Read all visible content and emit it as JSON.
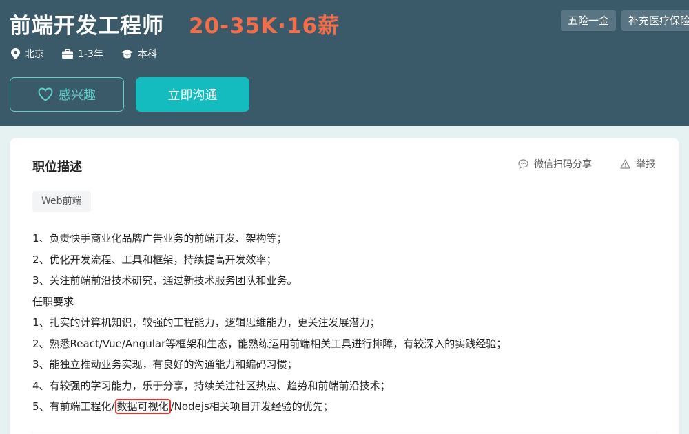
{
  "header": {
    "job_title": "前端开发工程师",
    "salary": "20-35K·16薪",
    "benefits": [
      "五险一金",
      "补充医疗保险"
    ],
    "location": "北京",
    "experience": "1-3年",
    "education": "本科",
    "interest_button": "感兴趣",
    "chat_button": "立即沟通"
  },
  "icons": {
    "location": "location-pin-icon",
    "experience": "briefcase-icon",
    "education": "graduation-cap-icon",
    "interest": "heart-icon",
    "share": "chat-bubble-icon",
    "report": "warning-icon"
  },
  "colors": {
    "header_bg": "#3a5a6a",
    "salary": "#f26d4a",
    "accent": "#15bcbf",
    "highlight_box": "#e0342a"
  },
  "card": {
    "title": "职位描述",
    "share_label": "微信扫码分享",
    "report_label": "举报",
    "tag": "Web前端",
    "lines": [
      "1、负责快手商业化品牌广告业务的前端开发、架构等；",
      "2、优化开发流程、工具和框架，持续提高开发效率；",
      "3、关注前端前沿技术研究，通过新技术服务团队和业务。",
      "任职要求",
      "1、扎实的计算机知识，较强的工程能力，逻辑思维能力，更关注发展潜力；",
      "2、熟悉React/Vue/Angular等框架和生态，能熟练运用前端相关工具进行排障，有较深入的实践经验；",
      "3、能独立推动业务实现，有良好的沟通能力和编码习惯；",
      "4、有较强的学习能力，乐于分享，持续关注社区热点、趋势和前端前沿技术；"
    ],
    "last_line": {
      "before": "5、有前端工程化/",
      "highlight": "数据可视化",
      "after": "/Nodejs相关项目开发经验的优先；"
    }
  }
}
